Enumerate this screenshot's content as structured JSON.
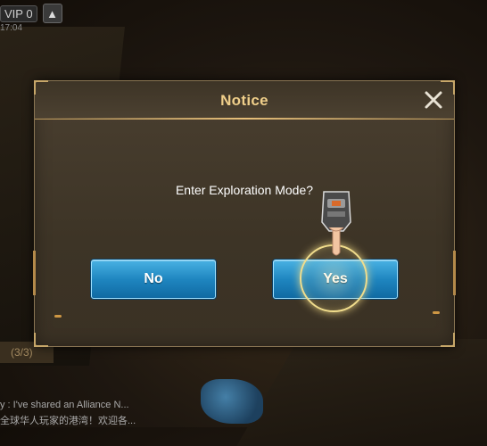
{
  "hud": {
    "vip_label": "VIP 0",
    "up_icon": "arrow-up-icon",
    "time_text": "17:04"
  },
  "background": {
    "progress_text": "(3/3)",
    "chat_lines": [
      "y : I've shared an Alliance N...",
      "全球华人玩家的港湾！欢迎各..."
    ]
  },
  "dialog": {
    "title": "Notice",
    "close_icon": "close-icon",
    "message": "Enter Exploration Mode?",
    "buttons": {
      "no_label": "No",
      "yes_label": "Yes"
    },
    "pointer_icon": "pointing-hand-icon"
  },
  "colors": {
    "title": "#f0cf8a",
    "button": "#1f86c0",
    "frame": "#8a7654"
  }
}
